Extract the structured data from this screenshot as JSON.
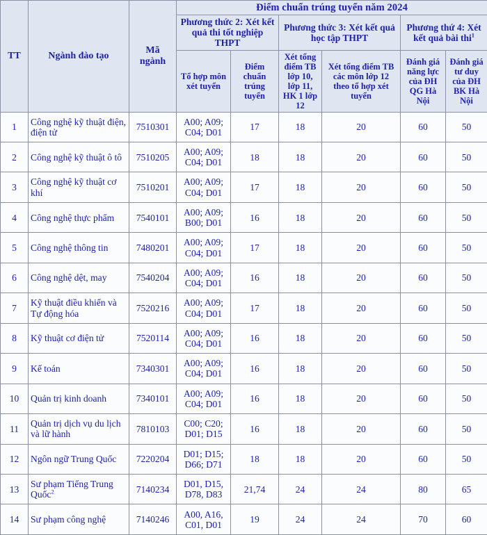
{
  "table": {
    "title": "Điểm chuẩn trúng tuyển năm 2024",
    "columns": {
      "tt": "TT",
      "nganh_dao_tao": "Ngành đào tạo",
      "ma_nganh": "Mã ngành",
      "method2": "Phương thức 2: Xét kết quả thi tốt nghiệp THPT",
      "method3": "Phương thức 3: Xét kết quả học tập THPT",
      "method4": "Phương thứ 4: Xét kết quả bài thi",
      "method4_sup": "1",
      "to_hop_mon": "Tổ hợp môn xét tuyển",
      "diem_chuan": "Điểm chuẩn trúng tuyển",
      "tb_10_11_12": "Xét tổng điểm TB lớp 10, lớp 11, HK 1 lớp 12",
      "tb_lop12": "Xét tổng điểm TB các môn lớp 12 theo tổ hợp xét tuyển",
      "dgnl_qg": "Đánh giá năng lực của ĐH QG Hà Nội",
      "dgtd_bk": "Đánh giá tư duy của ĐH BK Hà Nội"
    },
    "rows": [
      {
        "tt": "1",
        "nganh": "Công nghệ kỹ thuật điện, điện tử",
        "ma_nganh": "7510301",
        "to_hop": "A00; A09; C04; D01",
        "diem_chuan": "17",
        "tb_10_11_12": "18",
        "tb_lop12": "20",
        "dgnl_qg": "60",
        "dgtd_bk": "50"
      },
      {
        "tt": "2",
        "nganh": "Công nghệ kỹ thuật ô tô",
        "ma_nganh": "7510205",
        "to_hop": "A00; A09; C04; D01",
        "diem_chuan": "18",
        "tb_10_11_12": "18",
        "tb_lop12": "20",
        "dgnl_qg": "60",
        "dgtd_bk": "50"
      },
      {
        "tt": "3",
        "nganh": "Công nghệ kỹ thuật cơ khí",
        "ma_nganh": "7510201",
        "to_hop": "A00; A09; C04; D01",
        "diem_chuan": "17",
        "tb_10_11_12": "18",
        "tb_lop12": "20",
        "dgnl_qg": "60",
        "dgtd_bk": "50"
      },
      {
        "tt": "4",
        "nganh": "Công nghệ thực phẩm",
        "ma_nganh": "7540101",
        "to_hop": "A00; A09; B00; D01",
        "diem_chuan": "16",
        "tb_10_11_12": "18",
        "tb_lop12": "20",
        "dgnl_qg": "60",
        "dgtd_bk": "50"
      },
      {
        "tt": "5",
        "nganh": "Công nghệ thông tin",
        "ma_nganh": "7480201",
        "to_hop": "A00; A09; C04; D01",
        "diem_chuan": "17",
        "tb_10_11_12": "18",
        "tb_lop12": "20",
        "dgnl_qg": "60",
        "dgtd_bk": "50"
      },
      {
        "tt": "6",
        "nganh": "Công nghệ dệt, may",
        "ma_nganh": "7540204",
        "to_hop": "A00; A09; C04; D01",
        "diem_chuan": "16",
        "tb_10_11_12": "18",
        "tb_lop12": "20",
        "dgnl_qg": "60",
        "dgtd_bk": "50"
      },
      {
        "tt": "7",
        "nganh": "Kỹ thuật điều khiển và Tự động hóa",
        "ma_nganh": "7520216",
        "to_hop": "A00; A09; C04; D01",
        "diem_chuan": "17",
        "tb_10_11_12": "18",
        "tb_lop12": "20",
        "dgnl_qg": "60",
        "dgtd_bk": "50"
      },
      {
        "tt": "8",
        "nganh": "Kỹ thuật cơ điện tử",
        "ma_nganh": "7520114",
        "to_hop": "A00; A09; C04; D01",
        "diem_chuan": "16",
        "tb_10_11_12": "18",
        "tb_lop12": "20",
        "dgnl_qg": "60",
        "dgtd_bk": "50"
      },
      {
        "tt": "9",
        "nganh": "Kế toán",
        "ma_nganh": "7340301",
        "to_hop": "A00; A09; C04; D01",
        "diem_chuan": "16",
        "tb_10_11_12": "18",
        "tb_lop12": "20",
        "dgnl_qg": "60",
        "dgtd_bk": "50"
      },
      {
        "tt": "10",
        "nganh": "Quản trị kinh doanh",
        "ma_nganh": "7340101",
        "to_hop": "A00; A09; C04; D01",
        "diem_chuan": "16",
        "tb_10_11_12": "18",
        "tb_lop12": "20",
        "dgnl_qg": "60",
        "dgtd_bk": "50"
      },
      {
        "tt": "11",
        "nganh": "Quản trị dịch vụ du lịch và lữ hành",
        "ma_nganh": "7810103",
        "to_hop": "C00; C20; D01; D15",
        "diem_chuan": "16",
        "tb_10_11_12": "18",
        "tb_lop12": "20",
        "dgnl_qg": "60",
        "dgtd_bk": "50"
      },
      {
        "tt": "12",
        "nganh": "Ngôn ngữ Trung Quốc",
        "ma_nganh": "7220204",
        "to_hop": "D01; D15; D66; D71",
        "diem_chuan": "18",
        "tb_10_11_12": "18",
        "tb_lop12": "20",
        "dgnl_qg": "60",
        "dgtd_bk": "50"
      },
      {
        "tt": "13",
        "nganh": "Sư phạm Tiếng Trung Quốc",
        "nganh_sup": "2",
        "ma_nganh": "7140234",
        "to_hop": "D01, D15, D78, D83",
        "diem_chuan": "21,74",
        "tb_10_11_12": "24",
        "tb_lop12": "24",
        "dgnl_qg": "80",
        "dgtd_bk": "65"
      },
      {
        "tt": "14",
        "nganh": "Sư phạm công nghệ",
        "ma_nganh": "7140246",
        "to_hop": "A00, A16, C01, D01",
        "diem_chuan": "19",
        "tb_10_11_12": "24",
        "tb_lop12": "24",
        "dgnl_qg": "70",
        "dgtd_bk": "60"
      }
    ]
  },
  "colors": {
    "text": "#1f22a8",
    "header_background": "#dfe5f1",
    "cell_background": "#fbfcfe",
    "border": "#8b90a4"
  }
}
